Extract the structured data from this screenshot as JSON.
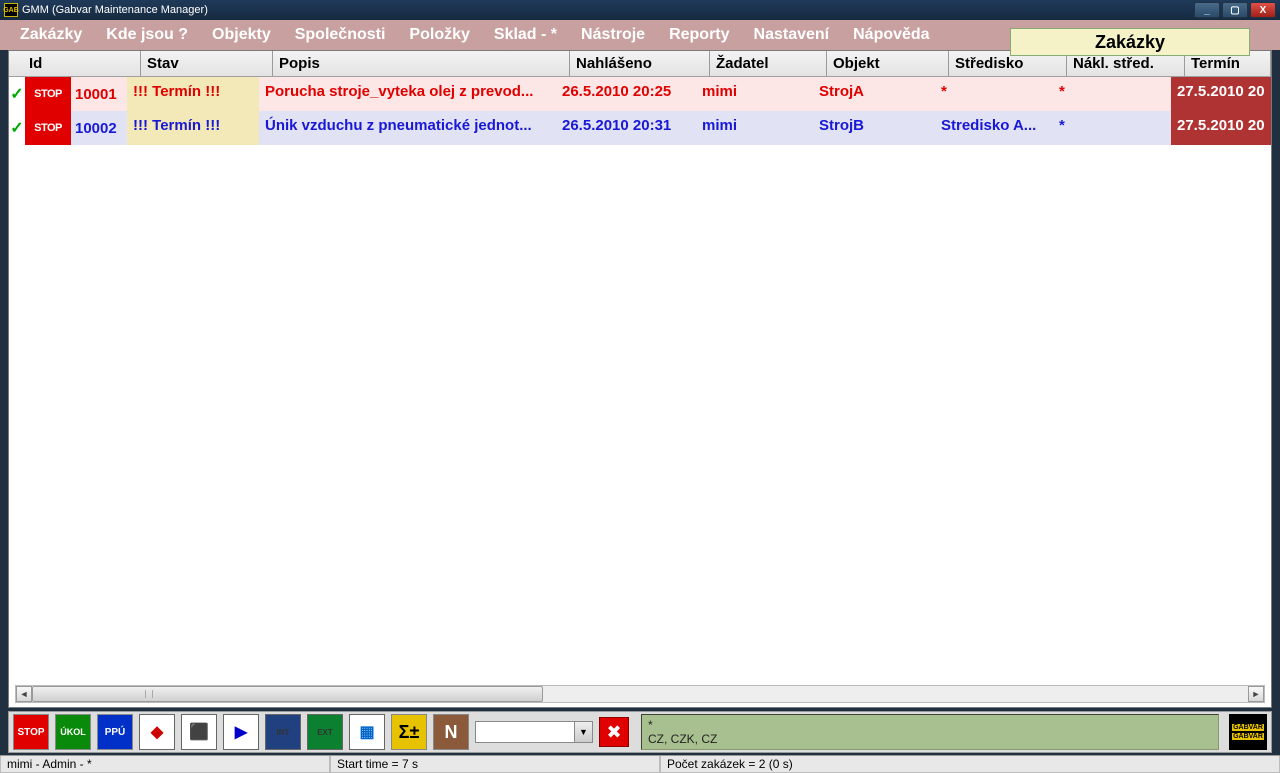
{
  "title": "GMM (Gabvar Maintenance Manager)",
  "menu": [
    "Zakázky",
    "Kde jsou ?",
    "Objekty",
    "Společnosti",
    "Položky",
    "Sklad - *",
    "Nástroje",
    "Reporty",
    "Nastavení",
    "Nápověda"
  ],
  "view_badge": "Zakázky",
  "columns": {
    "id": "Id",
    "stav": "Stav",
    "popis": "Popis",
    "nahl": "Nahlášeno",
    "zad": "Žadatel",
    "obj": "Objekt",
    "stred": "Středisko",
    "nakl": "Nákl. střed.",
    "term": "Termín"
  },
  "rows": [
    {
      "stop": "STOP",
      "id": "10001",
      "stav": "!!! Termín !!!",
      "popis": "Porucha stroje_vyteka olej z prevod...",
      "nahl": "26.5.2010 20:25",
      "zad": "mimi",
      "obj": "StrojA",
      "stred": "*",
      "nakl": "*",
      "term": "27.5.2010 20"
    },
    {
      "stop": "STOP",
      "id": "10002",
      "stav": "!!! Termín !!!",
      "popis": "Únik vzduchu z pneumatické jednot...",
      "nahl": "26.5.2010 20:31",
      "zad": "mimi",
      "obj": "StrojB",
      "stred": "Stredisko A...",
      "nakl": "*",
      "term": "27.5.2010 20"
    }
  ],
  "toolbar_labels": {
    "stop": "STOP",
    "ukol": "ÚKOL",
    "ppu": "PPÚ",
    "sum": "Σ±",
    "n": "N"
  },
  "info_panel": {
    "line1": "*",
    "line2": "CZ, CZK, CZ"
  },
  "status": {
    "user": "mimi - Admin - *",
    "time": "Start time = 7 s",
    "count": "Počet zakázek = 2    (0 s)"
  },
  "logo": "GABVAR",
  "icon": "GAB"
}
